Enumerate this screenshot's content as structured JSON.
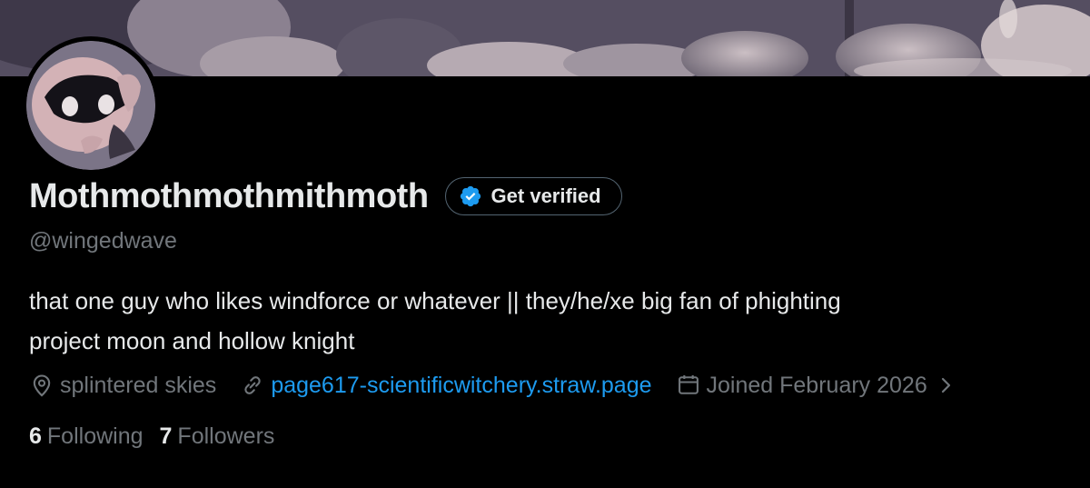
{
  "colors": {
    "background": "#000000",
    "primary_text": "#e7e9ea",
    "secondary_text": "#71767b",
    "link": "#1d9bf0",
    "verified_badge": "#1d9bf0"
  },
  "profile": {
    "display_name": "Mothmothmothmithmoth",
    "handle": "@wingedwave",
    "get_verified_label": "Get verified",
    "bio_line_1": "that one guy who likes windforce or whatever || they/he/xe big fan of phighting",
    "bio_line_2": "project moon and hollow knight",
    "location": "splintered skies",
    "website": "page617-scientificwitchery.straw.page",
    "joined": "Joined February 2026"
  },
  "stats": {
    "following_count": "6",
    "following_label": "Following",
    "followers_count": "7",
    "followers_label": "Followers"
  },
  "icons": {
    "verified": "verified-badge-icon",
    "location": "location-pin-icon",
    "website": "link-icon",
    "joined": "calendar-icon",
    "more": "chevron-right-icon"
  }
}
